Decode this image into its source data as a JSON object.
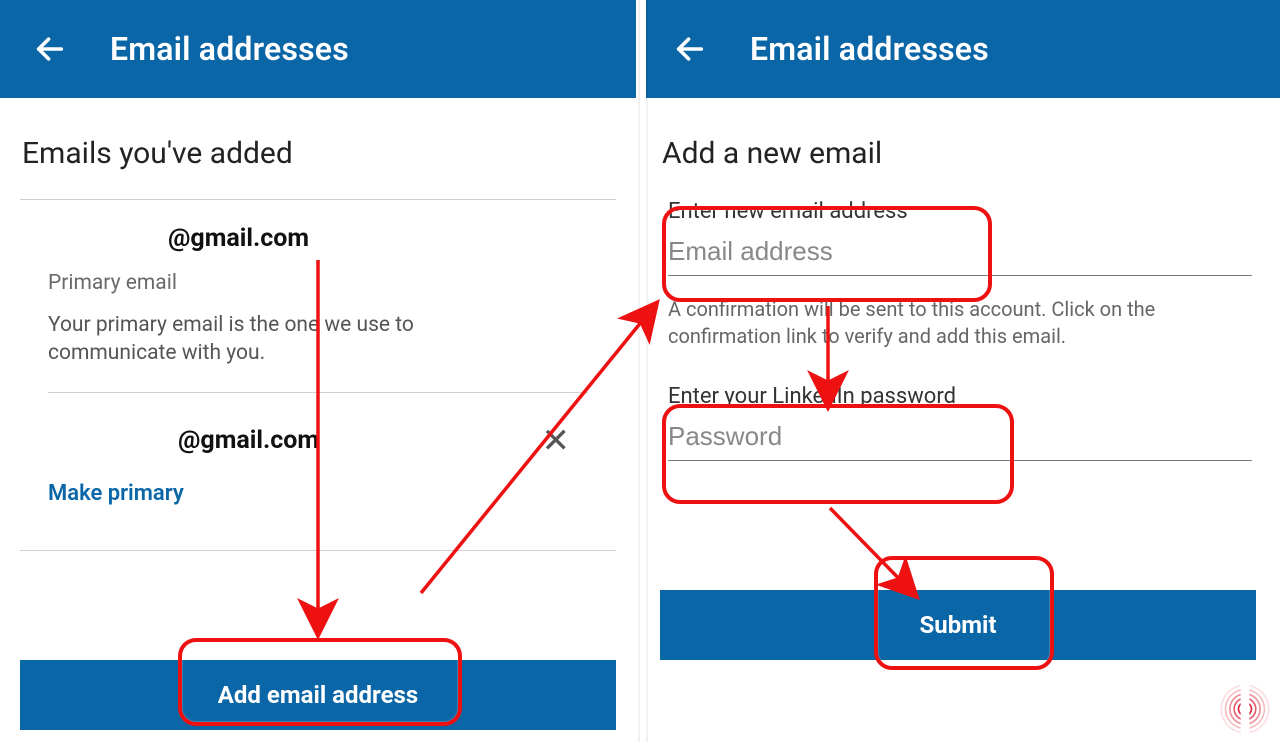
{
  "colors": {
    "primary": "#0a66a6",
    "annotation": "#e11"
  },
  "left": {
    "topbar_title": "Email addresses",
    "section_title": "Emails you've added",
    "primary_email": "@gmail.com",
    "primary_label": "Primary email",
    "primary_desc": "Your primary email is the one we use to communicate with you.",
    "secondary_email": "@gmail.com",
    "make_primary": "Make primary",
    "add_button": "Add email address"
  },
  "right": {
    "topbar_title": "Email addresses",
    "section_title": "Add a new email",
    "email_label": "Enter new email address",
    "email_placeholder": "Email address",
    "confirm_help": "A confirmation will be sent to this account. Click on the confirmation link to verify and add this email.",
    "password_label": "Enter your LinkedIn password",
    "password_placeholder": "Password",
    "submit_button": "Submit"
  }
}
